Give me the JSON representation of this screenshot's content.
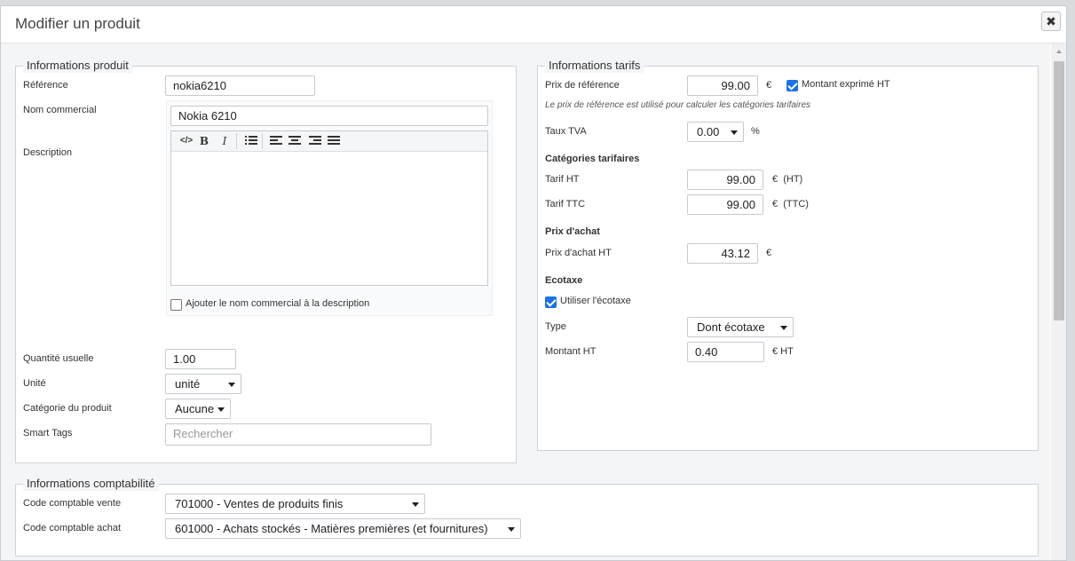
{
  "modal": {
    "title": "Modifier un produit",
    "close_label": "✖"
  },
  "product_info": {
    "legend": "Informations produit",
    "reference_label": "Référence",
    "reference_value": "nokia6210",
    "commercial_name_label": "Nom commercial",
    "commercial_name_value": "Nokia 6210",
    "description_label": "Description",
    "toolbar": {
      "code": "</>",
      "bold": "B",
      "italic": "I"
    },
    "add_name_checkbox_label": "Ajouter le nom commercial à la description",
    "quantity_label": "Quantité usuelle",
    "quantity_value": "1.00",
    "unit_label": "Unité",
    "unit_value": "unité",
    "category_label": "Catégorie du produit",
    "category_value": "Aucune",
    "smart_tags_label": "Smart Tags",
    "smart_tags_placeholder": "Rechercher"
  },
  "pricing": {
    "legend": "Informations tarifs",
    "ref_price_label": "Prix de référence",
    "ref_price_value": "99.00",
    "currency": "€",
    "ht_checkbox_label": "Montant exprimé HT",
    "ref_note": "Le prix de référence est utilisé pour calculer les catégories tarifaires",
    "tva_label": "Taux TVA",
    "tva_value": "0.00",
    "percent": "%",
    "categories_title": "Catégories tarifaires",
    "tarif_ht_label": "Tarif HT",
    "tarif_ht_value": "99.00",
    "tarif_ht_unit": "€  (HT)",
    "tarif_ttc_label": "Tarif TTC",
    "tarif_ttc_value": "99.00",
    "tarif_ttc_unit": "€  (TTC)",
    "purchase_title": "Prix d'achat",
    "purchase_label": "Prix d'achat HT",
    "purchase_value": "43.12",
    "ecotax_title": "Ecotaxe",
    "ecotax_checkbox_label": "Utiliser l'écotaxe",
    "type_label": "Type",
    "type_value": "Dont écotaxe",
    "amount_label": "Montant HT",
    "amount_value": "0.40",
    "amount_unit": "€ HT"
  },
  "accounting": {
    "legend": "Informations comptabilité",
    "sale_label": "Code comptable vente",
    "sale_value": "701000 - Ventes de produits finis",
    "purchase_label": "Code comptable achat",
    "purchase_value": "601000 - Achats stockés - Matières premières (et fournitures)"
  },
  "colors": {
    "accent": "#1a73e8",
    "border": "#cfd3d7",
    "background": "#f4f5f7"
  }
}
